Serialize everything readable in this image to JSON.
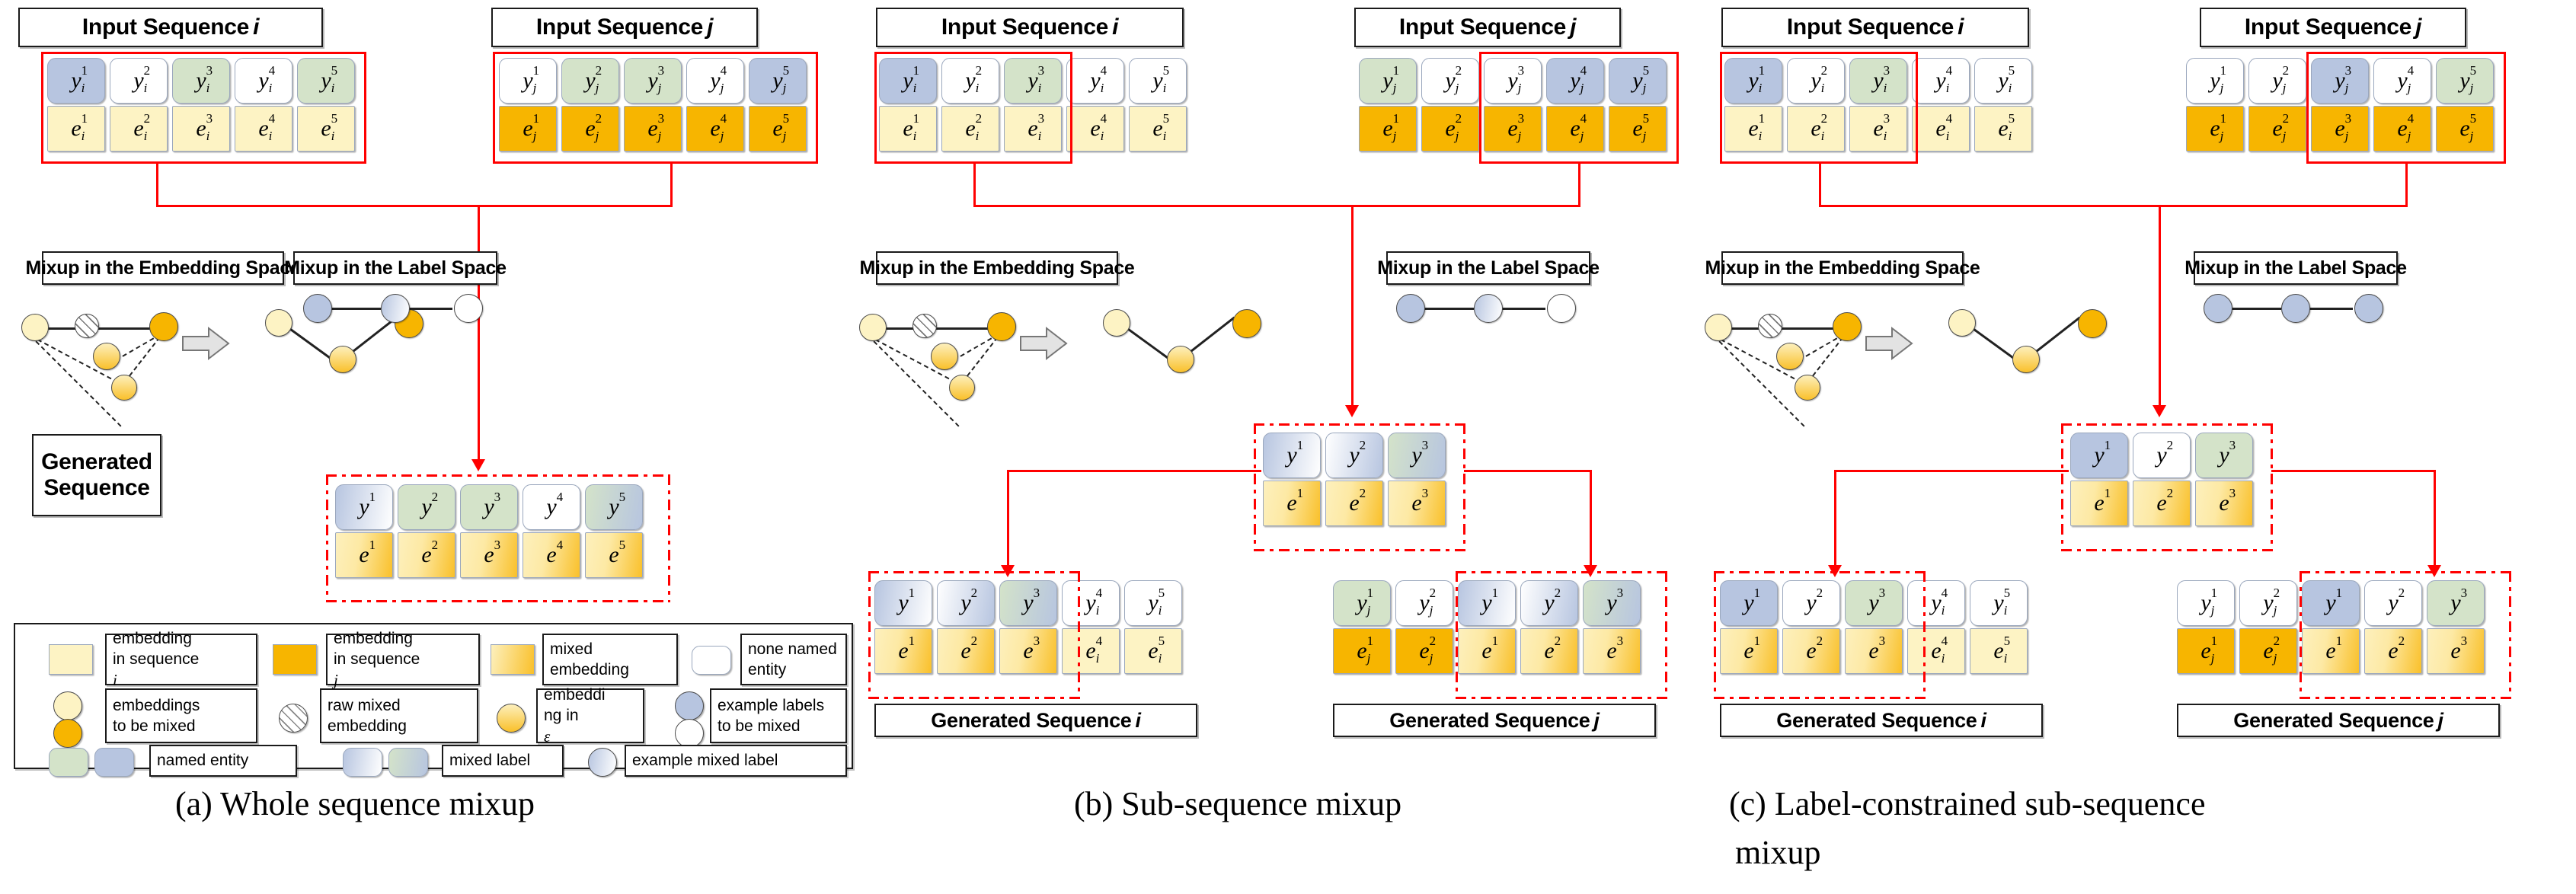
{
  "figure": {
    "captions": [
      {
        "id": "a",
        "text": "(a)  Whole sequence mixup"
      },
      {
        "id": "b",
        "text": "(b)  Sub-sequence mixup"
      },
      {
        "id": "c",
        "text": "(c)   Label-constrained    sub-sequence"
      },
      {
        "id": "c2",
        "text": "mixup"
      }
    ]
  },
  "headers": {
    "input_seq_i": "Input Sequence",
    "input_seq_i_sub": "i",
    "input_seq_j": "Input Sequence",
    "input_seq_j_sub": "j",
    "mixup_embedding": "Mixup in the Embedding Space",
    "mixup_label": "Mixup in the Label Space",
    "generated_sequence_line1": "Generated",
    "generated_sequence_line2": "Sequence",
    "generated_sequence_i": "Generated Sequence",
    "generated_sequence_i_sub": "i",
    "generated_sequence_j": "Generated Sequence",
    "generated_sequence_j_sub": "j"
  },
  "colors": {
    "accent_red": "#ff0000",
    "label_blue": "#b7c5e0",
    "label_green": "#d4e3c9",
    "label_white": "#ffffff",
    "embedding_i": "#fdf3c4",
    "embedding_j": "#f7b500",
    "border": "#1a1a1a"
  },
  "panels": {
    "a": {
      "title": "Whole sequence mixup",
      "input_i": {
        "labels": [
          {
            "t": "y",
            "sup": "1",
            "sub": "i",
            "fill": "blue"
          },
          {
            "t": "y",
            "sup": "2",
            "sub": "i",
            "fill": "white"
          },
          {
            "t": "y",
            "sup": "3",
            "sub": "i",
            "fill": "green"
          },
          {
            "t": "y",
            "sup": "4",
            "sub": "i",
            "fill": "white"
          },
          {
            "t": "y",
            "sup": "5",
            "sub": "i",
            "fill": "green"
          }
        ],
        "embeddings": [
          {
            "t": "e",
            "sup": "1",
            "sub": "i",
            "fill": "emb-i"
          },
          {
            "t": "e",
            "sup": "2",
            "sub": "i",
            "fill": "emb-i"
          },
          {
            "t": "e",
            "sup": "3",
            "sub": "i",
            "fill": "emb-i"
          },
          {
            "t": "e",
            "sup": "4",
            "sub": "i",
            "fill": "emb-i"
          },
          {
            "t": "e",
            "sup": "5",
            "sub": "i",
            "fill": "emb-i"
          }
        ],
        "selection": "all"
      },
      "input_j": {
        "labels": [
          {
            "t": "y",
            "sup": "1",
            "sub": "j",
            "fill": "white"
          },
          {
            "t": "y",
            "sup": "2",
            "sub": "j",
            "fill": "green"
          },
          {
            "t": "y",
            "sup": "3",
            "sub": "j",
            "fill": "green"
          },
          {
            "t": "y",
            "sup": "4",
            "sub": "j",
            "fill": "white"
          },
          {
            "t": "y",
            "sup": "5",
            "sub": "j",
            "fill": "blue"
          }
        ],
        "embeddings": [
          {
            "t": "e",
            "sup": "1",
            "sub": "j",
            "fill": "emb-j"
          },
          {
            "t": "e",
            "sup": "2",
            "sub": "j",
            "fill": "emb-j"
          },
          {
            "t": "e",
            "sup": "3",
            "sub": "j",
            "fill": "emb-j"
          },
          {
            "t": "e",
            "sup": "4",
            "sub": "j",
            "fill": "emb-j"
          },
          {
            "t": "e",
            "sup": "5",
            "sub": "j",
            "fill": "emb-j"
          }
        ],
        "selection": "all"
      },
      "generated": {
        "labels": [
          {
            "t": "y",
            "sup": "1",
            "sub": "",
            "fill": "mix-bw"
          },
          {
            "t": "y",
            "sup": "2",
            "sub": "",
            "fill": "green"
          },
          {
            "t": "y",
            "sup": "3",
            "sub": "",
            "fill": "green"
          },
          {
            "t": "y",
            "sup": "4",
            "sub": "",
            "fill": "white"
          },
          {
            "t": "y",
            "sup": "5",
            "sub": "",
            "fill": "mix-gb"
          }
        ],
        "embeddings": [
          {
            "t": "e",
            "sup": "1",
            "sub": "",
            "fill": "mix-e"
          },
          {
            "t": "e",
            "sup": "2",
            "sub": "",
            "fill": "mix-e"
          },
          {
            "t": "e",
            "sup": "3",
            "sub": "",
            "fill": "mix-e"
          },
          {
            "t": "e",
            "sup": "4",
            "sub": "",
            "fill": "mix-e"
          },
          {
            "t": "e",
            "sup": "5",
            "sub": "",
            "fill": "mix-e"
          }
        ]
      },
      "label_space_nodes": [
        "blue",
        "mixlab",
        "wht"
      ]
    },
    "b": {
      "title": "Sub-sequence mixup",
      "input_i": {
        "labels": [
          {
            "t": "y",
            "sup": "1",
            "sub": "i",
            "fill": "blue"
          },
          {
            "t": "y",
            "sup": "2",
            "sub": "i",
            "fill": "white"
          },
          {
            "t": "y",
            "sup": "3",
            "sub": "i",
            "fill": "green"
          },
          {
            "t": "y",
            "sup": "4",
            "sub": "i",
            "fill": "white"
          },
          {
            "t": "y",
            "sup": "5",
            "sub": "i",
            "fill": "white"
          }
        ],
        "embeddings": [
          {
            "t": "e",
            "sup": "1",
            "sub": "i",
            "fill": "emb-i"
          },
          {
            "t": "e",
            "sup": "2",
            "sub": "i",
            "fill": "emb-i"
          },
          {
            "t": "e",
            "sup": "3",
            "sub": "i",
            "fill": "emb-i"
          },
          {
            "t": "e",
            "sup": "4",
            "sub": "i",
            "fill": "emb-i"
          },
          {
            "t": "e",
            "sup": "5",
            "sub": "i",
            "fill": "emb-i"
          }
        ],
        "selection": "1-3"
      },
      "input_j": {
        "labels": [
          {
            "t": "y",
            "sup": "1",
            "sub": "j",
            "fill": "green"
          },
          {
            "t": "y",
            "sup": "2",
            "sub": "j",
            "fill": "white"
          },
          {
            "t": "y",
            "sup": "3",
            "sub": "j",
            "fill": "white"
          },
          {
            "t": "y",
            "sup": "4",
            "sub": "j",
            "fill": "blue"
          },
          {
            "t": "y",
            "sup": "5",
            "sub": "j",
            "fill": "blue"
          }
        ],
        "embeddings": [
          {
            "t": "e",
            "sup": "1",
            "sub": "j",
            "fill": "emb-j"
          },
          {
            "t": "e",
            "sup": "2",
            "sub": "j",
            "fill": "emb-j"
          },
          {
            "t": "e",
            "sup": "3",
            "sub": "j",
            "fill": "emb-j"
          },
          {
            "t": "e",
            "sup": "4",
            "sub": "j",
            "fill": "emb-j"
          },
          {
            "t": "e",
            "sup": "5",
            "sub": "j",
            "fill": "emb-j"
          }
        ],
        "selection": "3-5"
      },
      "mixed": {
        "labels": [
          {
            "t": "y",
            "sup": "1",
            "sub": "",
            "fill": "mix-bw"
          },
          {
            "t": "y",
            "sup": "2",
            "sub": "",
            "fill": "mix-wb"
          },
          {
            "t": "y",
            "sup": "3",
            "sub": "",
            "fill": "mix-gb"
          }
        ],
        "embeddings": [
          {
            "t": "e",
            "sup": "1",
            "sub": "",
            "fill": "mix-e"
          },
          {
            "t": "e",
            "sup": "2",
            "sub": "",
            "fill": "mix-e"
          },
          {
            "t": "e",
            "sup": "3",
            "sub": "",
            "fill": "mix-e"
          }
        ]
      },
      "generated_i": {
        "labels": [
          {
            "t": "y",
            "sup": "1",
            "sub": "",
            "fill": "mix-bw"
          },
          {
            "t": "y",
            "sup": "2",
            "sub": "",
            "fill": "mix-wb"
          },
          {
            "t": "y",
            "sup": "3",
            "sub": "",
            "fill": "mix-gb"
          },
          {
            "t": "y",
            "sup": "4",
            "sub": "i",
            "fill": "white"
          },
          {
            "t": "y",
            "sup": "5",
            "sub": "i",
            "fill": "white"
          }
        ],
        "embeddings": [
          {
            "t": "e",
            "sup": "1",
            "sub": "",
            "fill": "mix-e"
          },
          {
            "t": "e",
            "sup": "2",
            "sub": "",
            "fill": "mix-e"
          },
          {
            "t": "e",
            "sup": "3",
            "sub": "",
            "fill": "mix-e"
          },
          {
            "t": "e",
            "sup": "4",
            "sub": "i",
            "fill": "emb-i"
          },
          {
            "t": "e",
            "sup": "5",
            "sub": "i",
            "fill": "emb-i"
          }
        ]
      },
      "generated_j": {
        "labels": [
          {
            "t": "y",
            "sup": "1",
            "sub": "j",
            "fill": "green"
          },
          {
            "t": "y",
            "sup": "2",
            "sub": "j",
            "fill": "white"
          },
          {
            "t": "y",
            "sup": "1",
            "sub": "",
            "fill": "mix-bw"
          },
          {
            "t": "y",
            "sup": "2",
            "sub": "",
            "fill": "mix-wb"
          },
          {
            "t": "y",
            "sup": "3",
            "sub": "",
            "fill": "mix-gb"
          }
        ],
        "embeddings": [
          {
            "t": "e",
            "sup": "1",
            "sub": "j",
            "fill": "emb-j"
          },
          {
            "t": "e",
            "sup": "2",
            "sub": "j",
            "fill": "emb-j"
          },
          {
            "t": "e",
            "sup": "1",
            "sub": "",
            "fill": "mix-e"
          },
          {
            "t": "e",
            "sup": "2",
            "sub": "",
            "fill": "mix-e"
          },
          {
            "t": "e",
            "sup": "3",
            "sub": "",
            "fill": "mix-e"
          }
        ]
      },
      "label_space_nodes": [
        "blue",
        "mixlab",
        "wht"
      ]
    },
    "c": {
      "title": "Label-constrained sub-sequence mixup",
      "input_i": {
        "labels": [
          {
            "t": "y",
            "sup": "1",
            "sub": "i",
            "fill": "blue"
          },
          {
            "t": "y",
            "sup": "2",
            "sub": "i",
            "fill": "white"
          },
          {
            "t": "y",
            "sup": "3",
            "sub": "i",
            "fill": "green"
          },
          {
            "t": "y",
            "sup": "4",
            "sub": "i",
            "fill": "white"
          },
          {
            "t": "y",
            "sup": "5",
            "sub": "i",
            "fill": "white"
          }
        ],
        "embeddings": [
          {
            "t": "e",
            "sup": "1",
            "sub": "i",
            "fill": "emb-i"
          },
          {
            "t": "e",
            "sup": "2",
            "sub": "i",
            "fill": "emb-i"
          },
          {
            "t": "e",
            "sup": "3",
            "sub": "i",
            "fill": "emb-i"
          },
          {
            "t": "e",
            "sup": "4",
            "sub": "i",
            "fill": "emb-i"
          },
          {
            "t": "e",
            "sup": "5",
            "sub": "i",
            "fill": "emb-i"
          }
        ],
        "selection": "1-3"
      },
      "input_j": {
        "labels": [
          {
            "t": "y",
            "sup": "1",
            "sub": "j",
            "fill": "white"
          },
          {
            "t": "y",
            "sup": "2",
            "sub": "j",
            "fill": "white"
          },
          {
            "t": "y",
            "sup": "3",
            "sub": "j",
            "fill": "blue"
          },
          {
            "t": "y",
            "sup": "4",
            "sub": "j",
            "fill": "white"
          },
          {
            "t": "y",
            "sup": "5",
            "sub": "j",
            "fill": "green"
          }
        ],
        "embeddings": [
          {
            "t": "e",
            "sup": "1",
            "sub": "j",
            "fill": "emb-j"
          },
          {
            "t": "e",
            "sup": "2",
            "sub": "j",
            "fill": "emb-j"
          },
          {
            "t": "e",
            "sup": "3",
            "sub": "j",
            "fill": "emb-j"
          },
          {
            "t": "e",
            "sup": "4",
            "sub": "j",
            "fill": "emb-j"
          },
          {
            "t": "e",
            "sup": "5",
            "sub": "j",
            "fill": "emb-j"
          }
        ],
        "selection": "3-5"
      },
      "mixed": {
        "labels": [
          {
            "t": "y",
            "sup": "1",
            "sub": "",
            "fill": "blue"
          },
          {
            "t": "y",
            "sup": "2",
            "sub": "",
            "fill": "white"
          },
          {
            "t": "y",
            "sup": "3",
            "sub": "",
            "fill": "green"
          }
        ],
        "embeddings": [
          {
            "t": "e",
            "sup": "1",
            "sub": "",
            "fill": "mix-e"
          },
          {
            "t": "e",
            "sup": "2",
            "sub": "",
            "fill": "mix-e"
          },
          {
            "t": "e",
            "sup": "3",
            "sub": "",
            "fill": "mix-e"
          }
        ]
      },
      "generated_i": {
        "labels": [
          {
            "t": "y",
            "sup": "1",
            "sub": "",
            "fill": "blue"
          },
          {
            "t": "y",
            "sup": "2",
            "sub": "",
            "fill": "white"
          },
          {
            "t": "y",
            "sup": "3",
            "sub": "",
            "fill": "green"
          },
          {
            "t": "y",
            "sup": "4",
            "sub": "i",
            "fill": "white"
          },
          {
            "t": "y",
            "sup": "5",
            "sub": "i",
            "fill": "white"
          }
        ],
        "embeddings": [
          {
            "t": "e",
            "sup": "1",
            "sub": "",
            "fill": "mix-e"
          },
          {
            "t": "e",
            "sup": "2",
            "sub": "",
            "fill": "mix-e"
          },
          {
            "t": "e",
            "sup": "3",
            "sub": "",
            "fill": "mix-e"
          },
          {
            "t": "e",
            "sup": "4",
            "sub": "i",
            "fill": "emb-i"
          },
          {
            "t": "e",
            "sup": "5",
            "sub": "i",
            "fill": "emb-i"
          }
        ]
      },
      "generated_j": {
        "labels": [
          {
            "t": "y",
            "sup": "1",
            "sub": "j",
            "fill": "white"
          },
          {
            "t": "y",
            "sup": "2",
            "sub": "j",
            "fill": "white"
          },
          {
            "t": "y",
            "sup": "1",
            "sub": "",
            "fill": "blue"
          },
          {
            "t": "y",
            "sup": "2",
            "sub": "",
            "fill": "white"
          },
          {
            "t": "y",
            "sup": "3",
            "sub": "",
            "fill": "green"
          }
        ],
        "embeddings": [
          {
            "t": "e",
            "sup": "1",
            "sub": "j",
            "fill": "emb-j"
          },
          {
            "t": "e",
            "sup": "2",
            "sub": "j",
            "fill": "emb-j"
          },
          {
            "t": "e",
            "sup": "1",
            "sub": "",
            "fill": "mix-e"
          },
          {
            "t": "e",
            "sup": "2",
            "sub": "",
            "fill": "mix-e"
          },
          {
            "t": "e",
            "sup": "3",
            "sub": "",
            "fill": "mix-e"
          }
        ]
      },
      "label_space_nodes": [
        "blue",
        "blue",
        "blue"
      ]
    }
  },
  "legend": {
    "items": [
      {
        "id": "embedding-in-sequence-i",
        "lines": [
          "embedding",
          "in sequence "
        ],
        "italic": "i",
        "swatch": "rect-emb-i"
      },
      {
        "id": "embedding-in-sequence-j",
        "lines": [
          "embedding",
          "in sequence "
        ],
        "italic": "j",
        "swatch": "rect-emb-j"
      },
      {
        "id": "mixed-embedding",
        "lines": [
          "mixed",
          "embedding"
        ],
        "italic": "",
        "swatch": "rect-mix"
      },
      {
        "id": "none-named-entity",
        "lines": [
          "none named",
          "entity"
        ],
        "italic": "",
        "swatch": "rounded-white"
      },
      {
        "id": "embeddings-to-be-mixed",
        "lines": [
          "embeddings",
          "to be mixed"
        ],
        "italic": "",
        "swatch": "circ-pale-org"
      },
      {
        "id": "raw-mixed-embedding",
        "lines": [
          "raw mixed",
          "embedding"
        ],
        "italic": "",
        "swatch": "circ-hatch"
      },
      {
        "id": "embedding-in-E",
        "lines": [
          "embeddi",
          "ng in "
        ],
        "italic": "ε",
        "swatch": "circ-mix"
      },
      {
        "id": "example-labels-to-be-mixed",
        "lines": [
          "example labels",
          "to be mixed"
        ],
        "italic": "",
        "swatch": "circ-blue-white"
      },
      {
        "id": "named-entity",
        "lines": [
          "named entity"
        ],
        "italic": "",
        "swatch": "rounded-green-blue"
      },
      {
        "id": "mixed-label",
        "lines": [
          "mixed label"
        ],
        "italic": "",
        "swatch": "rounded-mix-label"
      },
      {
        "id": "example-mixed-label",
        "lines": [
          "example mixed label"
        ],
        "italic": "",
        "swatch": "circ-mix-label"
      }
    ]
  }
}
